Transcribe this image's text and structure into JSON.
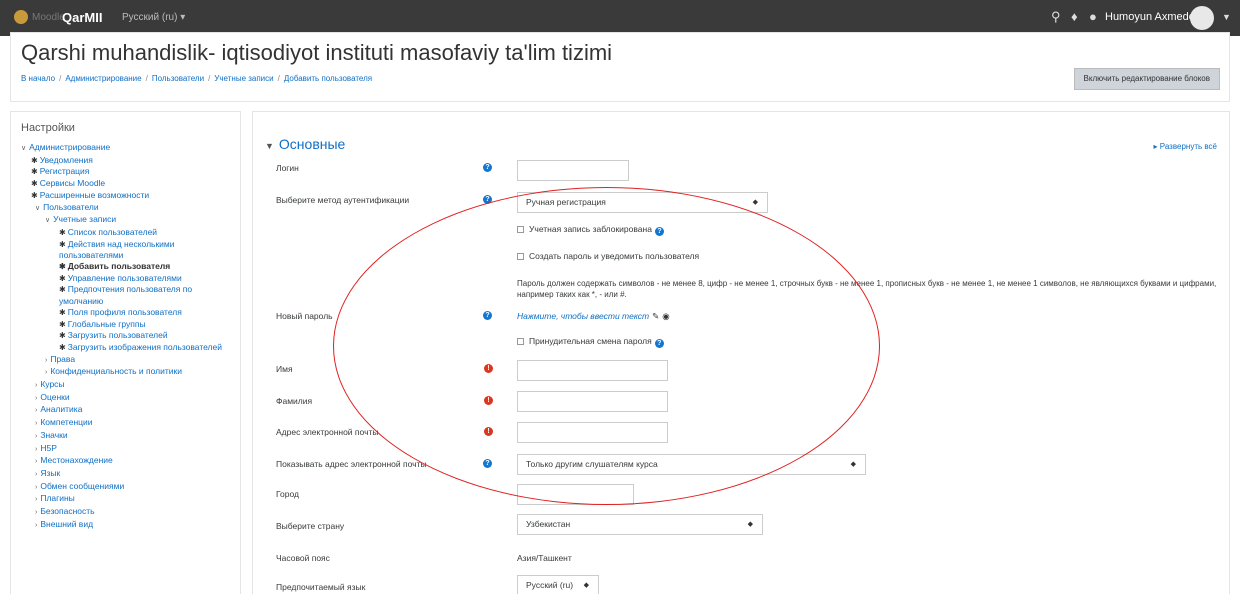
{
  "navbar": {
    "logo_text": "Moodle",
    "brand": "QarMII",
    "language": "Русский (ru) ▾",
    "user_name": "Humoyun Axmedov",
    "icons": [
      "search-icon",
      "bell-icon",
      "chat-icon",
      "user-avatar",
      "chevron-down-icon"
    ]
  },
  "header": {
    "title": "Qarshi muhandislik- iqtisodiyot instituti masofaviy ta'lim tizimi",
    "breadcrumb": [
      "В начало",
      "Администрирование",
      "Пользователи",
      "Учетные записи",
      "Добавить пользователя"
    ],
    "edit_button": "Включить редактирование блоков"
  },
  "sidebar": {
    "title": "Настройки",
    "items": [
      {
        "label": "Администрирование",
        "icon": "chevron-down-icon"
      },
      {
        "label": "Уведомления",
        "icon": "gear-icon"
      },
      {
        "label": "Регистрация",
        "icon": "gear-icon"
      },
      {
        "label": "Сервисы Moodle",
        "icon": "gear-icon"
      },
      {
        "label": "Расширенные возможности",
        "icon": "gear-icon"
      },
      {
        "label": "Пользователи",
        "icon": "chevron-down-icon"
      },
      {
        "label": "Учетные записи",
        "icon": "chevron-down-icon"
      },
      {
        "label": "Список пользователей",
        "icon": "gear-icon"
      },
      {
        "label": "Действия над несколькими пользователями",
        "icon": "gear-icon"
      },
      {
        "label": "Добавить пользователя",
        "icon": "gear-icon",
        "active": true
      },
      {
        "label": "Управление пользователями",
        "icon": "gear-icon"
      },
      {
        "label": "Предпочтения пользователя по умолчанию",
        "icon": "gear-icon"
      },
      {
        "label": "Поля профиля пользователя",
        "icon": "gear-icon"
      },
      {
        "label": "Глобальные группы",
        "icon": "gear-icon"
      },
      {
        "label": "Загрузить пользователей",
        "icon": "gear-icon"
      },
      {
        "label": "Загрузить изображения пользователей",
        "icon": "gear-icon"
      },
      {
        "label": "Права",
        "icon": "chevron-right-icon"
      },
      {
        "label": "Конфиденциальность и политики",
        "icon": "chevron-right-icon"
      },
      {
        "label": "Курсы",
        "icon": "chevron-right-icon"
      },
      {
        "label": "Оценки",
        "icon": "chevron-right-icon"
      },
      {
        "label": "Аналитика",
        "icon": "chevron-right-icon"
      },
      {
        "label": "Компетенции",
        "icon": "chevron-right-icon"
      },
      {
        "label": "Значки",
        "icon": "chevron-right-icon"
      },
      {
        "label": "H5P",
        "icon": "chevron-right-icon"
      },
      {
        "label": "Местонахождение",
        "icon": "chevron-right-icon"
      },
      {
        "label": "Язык",
        "icon": "chevron-right-icon"
      },
      {
        "label": "Обмен сообщениями",
        "icon": "chevron-right-icon"
      },
      {
        "label": "Плагины",
        "icon": "chevron-right-icon"
      },
      {
        "label": "Безопасность",
        "icon": "chevron-right-icon"
      },
      {
        "label": "Внешний вид",
        "icon": "chevron-right-icon"
      }
    ]
  },
  "form": {
    "expand_all": "Развернуть всё",
    "section_title": "Основные",
    "labels": {
      "login": "Логин",
      "auth": "Выберите метод аутентификации",
      "new_password": "Новый пароль",
      "first_name": "Имя",
      "last_name": "Фамилия",
      "email": "Адрес электронной почты",
      "email_display": "Показывать адрес электронной почты",
      "city": "Город",
      "country": "Выберите страну",
      "timezone": "Часовой пояс",
      "language": "Предпочитаемый язык"
    },
    "auth_value": "Ручная регистрация",
    "suspended_label": "Учетная запись заблокирована",
    "create_password_label": "Создать пароль и уведомить пользователя",
    "password_rules": "Пароль должен содержать символов - не менее 8, цифр - не менее 1, строчных букв - не менее 1, прописных букв - не менее 1, не менее 1 символов, не являющихся буквами и цифрами, например таких как *, - или #.",
    "password_link": "Нажмите, чтобы ввести текст",
    "force_change_label": "Принудительная смена пароля",
    "email_display_value": "Только другим слушателям курса",
    "country_value": "Узбекистан",
    "timezone_value": "Азия/Ташкент",
    "language_value": "Русский (ru)"
  },
  "colors": {
    "annotation": "#e02020",
    "link": "#0f6fc5",
    "navbar": "#3a3a3a"
  }
}
